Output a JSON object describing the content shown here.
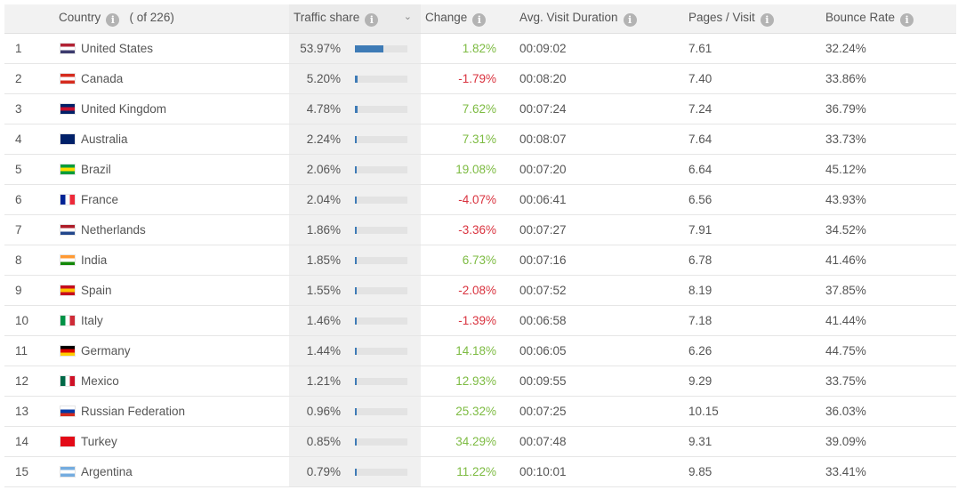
{
  "header": {
    "country": "Country",
    "count": "( of 226)",
    "traffic": "Traffic share",
    "change": "Change",
    "duration": "Avg. Visit Duration",
    "pages": "Pages / Visit",
    "bounce": "Bounce Rate"
  },
  "colors": {
    "bar": "#3e7bb6",
    "positive": "#7dbb42",
    "negative": "#d9323e"
  },
  "rows": [
    {
      "rank": "1",
      "country": "United States",
      "share": "53.97%",
      "share_value": 53.97,
      "change": "1.82%",
      "dir": "pos",
      "duration": "00:09:02",
      "pages": "7.61",
      "bounce": "32.24%",
      "flag": [
        "#b22234",
        "#fff",
        "#3c3b6e"
      ]
    },
    {
      "rank": "2",
      "country": "Canada",
      "share": "5.20%",
      "share_value": 5.2,
      "change": "-1.79%",
      "dir": "neg",
      "duration": "00:08:20",
      "pages": "7.40",
      "bounce": "33.86%",
      "flag": [
        "#d52b1e",
        "#fff",
        "#d52b1e"
      ]
    },
    {
      "rank": "3",
      "country": "United Kingdom",
      "share": "4.78%",
      "share_value": 4.78,
      "change": "7.62%",
      "dir": "pos",
      "duration": "00:07:24",
      "pages": "7.24",
      "bounce": "36.79%",
      "flag": [
        "#012169",
        "#c8102e",
        "#012169"
      ]
    },
    {
      "rank": "4",
      "country": "Australia",
      "share": "2.24%",
      "share_value": 2.24,
      "change": "7.31%",
      "dir": "pos",
      "duration": "00:08:07",
      "pages": "7.64",
      "bounce": "33.73%",
      "flag": [
        "#012169",
        "#012169",
        "#012169"
      ]
    },
    {
      "rank": "5",
      "country": "Brazil",
      "share": "2.06%",
      "share_value": 2.06,
      "change": "19.08%",
      "dir": "pos",
      "duration": "00:07:20",
      "pages": "6.64",
      "bounce": "45.12%",
      "flag": [
        "#009c3b",
        "#ffdf00",
        "#009c3b"
      ]
    },
    {
      "rank": "6",
      "country": "France",
      "share": "2.04%",
      "share_value": 2.04,
      "change": "-4.07%",
      "dir": "neg",
      "duration": "00:06:41",
      "pages": "6.56",
      "bounce": "43.93%",
      "flag": [
        "#002395",
        "#fff",
        "#ed2939"
      ],
      "vertical": true
    },
    {
      "rank": "7",
      "country": "Netherlands",
      "share": "1.86%",
      "share_value": 1.86,
      "change": "-3.36%",
      "dir": "neg",
      "duration": "00:07:27",
      "pages": "7.91",
      "bounce": "34.52%",
      "flag": [
        "#ae1c28",
        "#fff",
        "#21468b"
      ]
    },
    {
      "rank": "8",
      "country": "India",
      "share": "1.85%",
      "share_value": 1.85,
      "change": "6.73%",
      "dir": "pos",
      "duration": "00:07:16",
      "pages": "6.78",
      "bounce": "41.46%",
      "flag": [
        "#ff9933",
        "#fff",
        "#138808"
      ]
    },
    {
      "rank": "9",
      "country": "Spain",
      "share": "1.55%",
      "share_value": 1.55,
      "change": "-2.08%",
      "dir": "neg",
      "duration": "00:07:52",
      "pages": "8.19",
      "bounce": "37.85%",
      "flag": [
        "#c60b1e",
        "#ffc400",
        "#c60b1e"
      ]
    },
    {
      "rank": "10",
      "country": "Italy",
      "share": "1.46%",
      "share_value": 1.46,
      "change": "-1.39%",
      "dir": "neg",
      "duration": "00:06:58",
      "pages": "7.18",
      "bounce": "41.44%",
      "flag": [
        "#009246",
        "#fff",
        "#ce2b37"
      ],
      "vertical": true
    },
    {
      "rank": "11",
      "country": "Germany",
      "share": "1.44%",
      "share_value": 1.44,
      "change": "14.18%",
      "dir": "pos",
      "duration": "00:06:05",
      "pages": "6.26",
      "bounce": "44.75%",
      "flag": [
        "#000",
        "#dd0000",
        "#ffce00"
      ]
    },
    {
      "rank": "12",
      "country": "Mexico",
      "share": "1.21%",
      "share_value": 1.21,
      "change": "12.93%",
      "dir": "pos",
      "duration": "00:09:55",
      "pages": "9.29",
      "bounce": "33.75%",
      "flag": [
        "#006847",
        "#fff",
        "#ce1126"
      ],
      "vertical": true
    },
    {
      "rank": "13",
      "country": "Russian Federation",
      "share": "0.96%",
      "share_value": 0.96,
      "change": "25.32%",
      "dir": "pos",
      "duration": "00:07:25",
      "pages": "10.15",
      "bounce": "36.03%",
      "flag": [
        "#fff",
        "#0039a6",
        "#d52b1e"
      ]
    },
    {
      "rank": "14",
      "country": "Turkey",
      "share": "0.85%",
      "share_value": 0.85,
      "change": "34.29%",
      "dir": "pos",
      "duration": "00:07:48",
      "pages": "9.31",
      "bounce": "39.09%",
      "flag": [
        "#e30a17",
        "#e30a17",
        "#e30a17"
      ]
    },
    {
      "rank": "15",
      "country": "Argentina",
      "share": "0.79%",
      "share_value": 0.79,
      "change": "11.22%",
      "dir": "pos",
      "duration": "00:10:01",
      "pages": "9.85",
      "bounce": "33.41%",
      "flag": [
        "#74acdf",
        "#fff",
        "#74acdf"
      ]
    }
  ]
}
